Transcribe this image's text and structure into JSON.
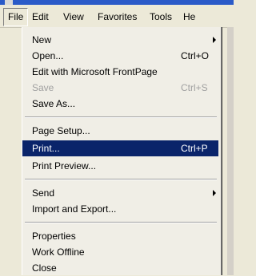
{
  "menubar": {
    "items": [
      {
        "label": "File"
      },
      {
        "label": "Edit"
      },
      {
        "label": "View"
      },
      {
        "label": "Favorites"
      },
      {
        "label": "Tools"
      },
      {
        "label": "He"
      }
    ]
  },
  "file_menu": {
    "items": [
      {
        "label": "New",
        "submenu": true
      },
      {
        "label": "Open...",
        "shortcut": "Ctrl+O"
      },
      {
        "label": "Edit with Microsoft FrontPage"
      },
      {
        "label": "Save",
        "shortcut": "Ctrl+S",
        "disabled": true
      },
      {
        "label": "Save As..."
      },
      {
        "label": "Page Setup..."
      },
      {
        "label": "Print...",
        "shortcut": "Ctrl+P",
        "highlighted": true
      },
      {
        "label": "Print Preview..."
      },
      {
        "label": "Send",
        "submenu": true
      },
      {
        "label": "Import and Export..."
      },
      {
        "label": "Properties"
      },
      {
        "label": "Work Offline"
      },
      {
        "label": "Close"
      }
    ]
  },
  "colors": {
    "highlight": "#0a246a",
    "disabled_text": "#a0a0a0",
    "menu_bg": "#f0eee6"
  }
}
